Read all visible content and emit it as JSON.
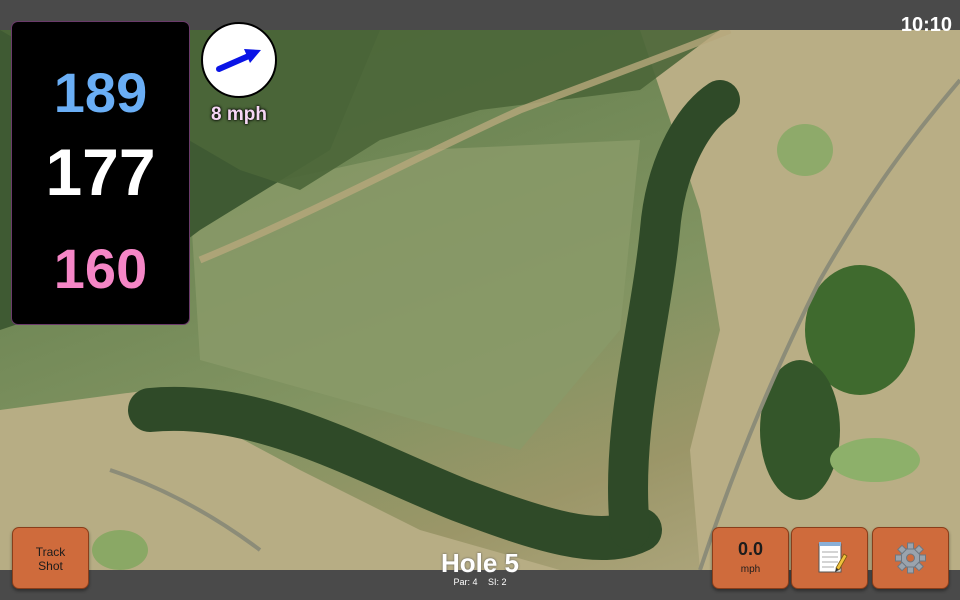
{
  "status": {
    "time": "10:10"
  },
  "distances": {
    "back": "189",
    "middle": "177",
    "front": "160"
  },
  "wind": {
    "speed": "8 mph",
    "icon": "wind-arrow-icon"
  },
  "hole": {
    "title": "Hole 5",
    "par": "Par: 4",
    "si": "SI: 2"
  },
  "buttons": {
    "track_shot": {
      "line1": "Track",
      "line2": "Shot"
    },
    "speed": {
      "value": "0.0",
      "unit": "mph"
    },
    "notes_icon": "notepad-icon",
    "settings_icon": "gear-icon"
  },
  "colors": {
    "back": "#6aaef5",
    "middle": "#ffffff",
    "front": "#f586c6",
    "button": "#cf6b3c",
    "wind_arrow": "#0a14e6"
  }
}
